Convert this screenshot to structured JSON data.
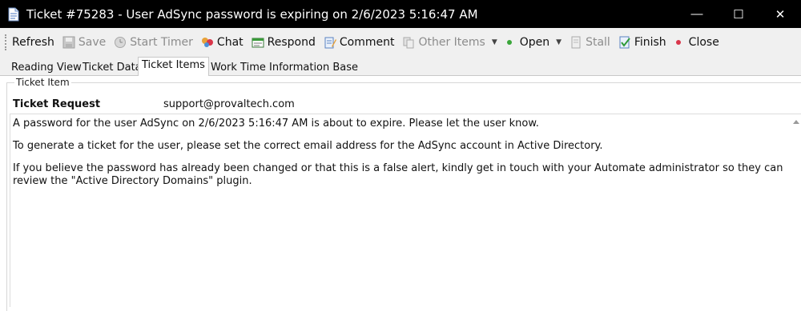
{
  "window": {
    "title": "Ticket #75283 - User AdSync password is expiring on 2/6/2023 5:16:47 AM",
    "minimize": "—",
    "maximize": "☐",
    "close": "✕"
  },
  "toolbar": {
    "refresh": "Refresh",
    "save": "Save",
    "start_timer": "Start Timer",
    "chat": "Chat",
    "respond": "Respond",
    "comment": "Comment",
    "other_items": "Other Items",
    "open": "Open",
    "stall": "Stall",
    "finish": "Finish",
    "close": "Close",
    "colors": {
      "open_dot": "#3aa63a",
      "close_dot": "#d9364a"
    }
  },
  "tabs": [
    {
      "label": "Reading View"
    },
    {
      "label": "Ticket Data"
    },
    {
      "label": "Ticket Items",
      "active": true
    },
    {
      "label": "Work Time"
    },
    {
      "label": "Information Base"
    }
  ],
  "ticket_item": {
    "group_title": "Ticket Item",
    "request_label": "Ticket Request",
    "email": "support@provaltech.com",
    "paragraphs": [
      "A password for the user AdSync on 2/6/2023 5:16:47 AM is about to expire. Please let the user know.",
      "To generate a ticket for the user, please set the correct email address for the AdSync account in Active Directory.",
      "If you believe the password has already been changed or that this is a false alert, kindly get in touch with your Automate administrator so they can review the \"Active Directory Domains\" plugin."
    ]
  }
}
